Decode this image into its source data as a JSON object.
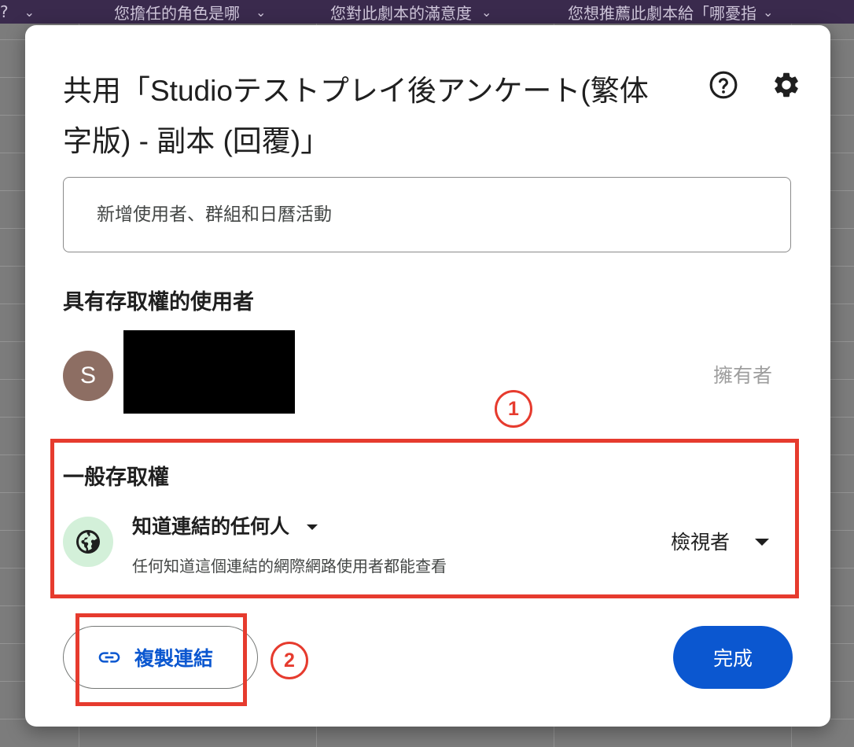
{
  "background": {
    "columns": [
      "?",
      "您擔任的角色是哪",
      "您對此劇本的滿意度",
      "您想推薦此劇本給「哪憂指"
    ]
  },
  "dialog": {
    "title": "共用「Studioテストプレイ後アンケート(繁体字版) - 副本 (回覆)」",
    "help_icon": "help-icon",
    "settings_icon": "gear-icon",
    "add_people": {
      "placeholder": "新增使用者、群組和日曆活動",
      "value": ""
    },
    "people_section": {
      "heading": "具有存取權的使用者",
      "users": [
        {
          "avatar_letter": "S",
          "avatar_color": "#8d6e63",
          "name": "",
          "role": "擁有者"
        }
      ]
    },
    "general_access": {
      "heading": "一般存取權",
      "icon": "globe-icon",
      "scope": "知道連結的任何人",
      "description": "任何知道這個連結的網際網路使用者都能查看",
      "role": "檢視者"
    },
    "buttons": {
      "copy_link": "複製連結",
      "done": "完成"
    }
  },
  "annotations": [
    {
      "number": "1",
      "color": "#e63b2e"
    },
    {
      "number": "2",
      "color": "#e63b2e"
    }
  ],
  "colors": {
    "accent": "#0b57d0",
    "annotation": "#e63b2e",
    "globe_bg": "#d3f0d9"
  }
}
